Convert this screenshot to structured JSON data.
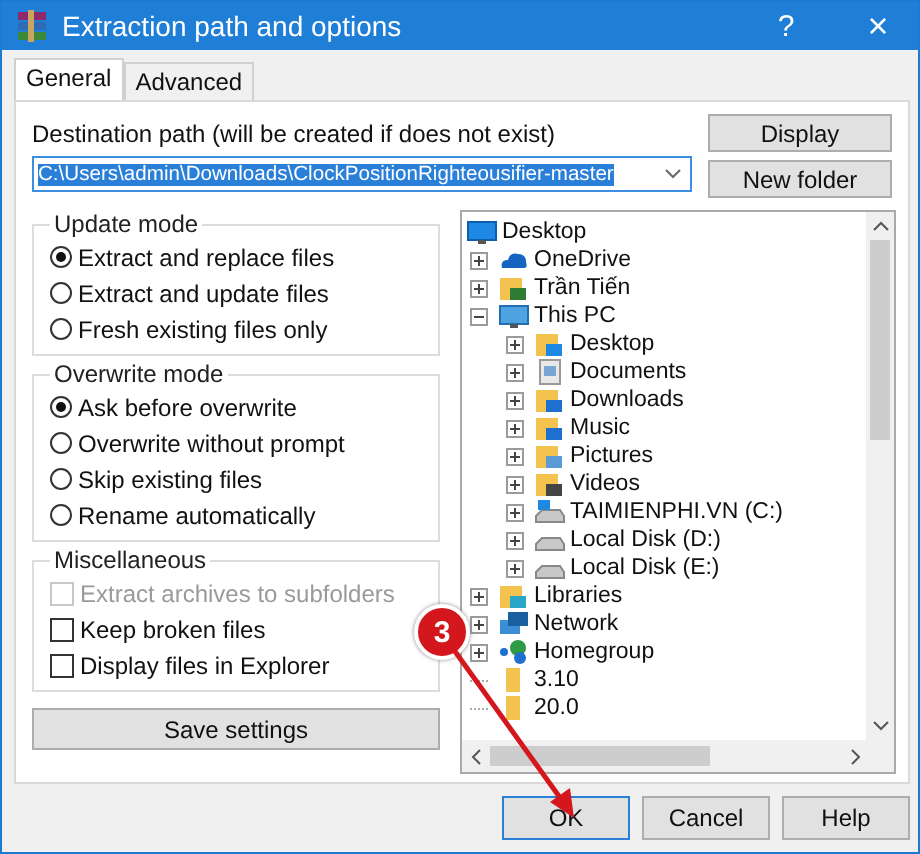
{
  "window": {
    "title": "Extraction path and options",
    "help": "?",
    "close": "×"
  },
  "tabs": [
    {
      "label": "General",
      "selected": true
    },
    {
      "label": "Advanced",
      "selected": false
    }
  ],
  "destination": {
    "label": "Destination path (will be created if does not exist)",
    "value": "C:\\Users\\admin\\Downloads\\ClockPositionRighteousifier-master"
  },
  "side_buttons": [
    "Display",
    "New folder"
  ],
  "update_mode": {
    "title": "Update mode",
    "options": [
      {
        "label": "Extract and replace files",
        "selected": true
      },
      {
        "label": "Extract and update files",
        "selected": false
      },
      {
        "label": "Fresh existing files only",
        "selected": false
      }
    ]
  },
  "overwrite_mode": {
    "title": "Overwrite mode",
    "options": [
      {
        "label": "Ask before overwrite",
        "selected": true
      },
      {
        "label": "Overwrite without prompt",
        "selected": false
      },
      {
        "label": "Skip existing files",
        "selected": false
      },
      {
        "label": "Rename automatically",
        "selected": false
      }
    ]
  },
  "miscellaneous": {
    "title": "Miscellaneous",
    "options": [
      {
        "label": "Extract archives to subfolders",
        "checked": false,
        "disabled": true
      },
      {
        "label": "Keep broken files",
        "checked": false,
        "disabled": false
      },
      {
        "label": "Display files in Explorer",
        "checked": false,
        "disabled": false
      }
    ]
  },
  "save_button": "Save settings",
  "folder_tree": [
    {
      "label": "Desktop",
      "kind": "desktop",
      "children": [
        {
          "label": "OneDrive",
          "kind": "cloud",
          "expanded": false
        },
        {
          "label": "Trần Tiến",
          "kind": "user",
          "expanded": false
        },
        {
          "label": "This PC",
          "kind": "pc",
          "expanded": true,
          "children": [
            {
              "label": "Desktop",
              "kind": "desktop-folder",
              "expanded": false
            },
            {
              "label": "Documents",
              "kind": "documents",
              "expanded": false
            },
            {
              "label": "Downloads",
              "kind": "downloads",
              "expanded": false
            },
            {
              "label": "Music",
              "kind": "music",
              "expanded": false
            },
            {
              "label": "Pictures",
              "kind": "pictures",
              "expanded": false
            },
            {
              "label": "Videos",
              "kind": "videos",
              "expanded": false
            },
            {
              "label": "TAIMIENPHI.VN (C:)",
              "kind": "system-drive",
              "expanded": false
            },
            {
              "label": "Local Disk (D:)",
              "kind": "drive",
              "expanded": false
            },
            {
              "label": "Local Disk (E:)",
              "kind": "drive",
              "expanded": false
            }
          ]
        },
        {
          "label": "Libraries",
          "kind": "library",
          "expanded": false
        },
        {
          "label": "Network",
          "kind": "network",
          "expanded": false
        },
        {
          "label": "Homegroup",
          "kind": "homegroup",
          "expanded": false
        },
        {
          "label": "3.10",
          "kind": "folder"
        },
        {
          "label": "20.0",
          "kind": "folder"
        }
      ]
    }
  ],
  "annotation": {
    "label": "3"
  },
  "buttons": [
    {
      "label": "OK",
      "default": true
    },
    {
      "label": "Cancel",
      "default": false
    },
    {
      "label": "Help",
      "default": false
    }
  ]
}
